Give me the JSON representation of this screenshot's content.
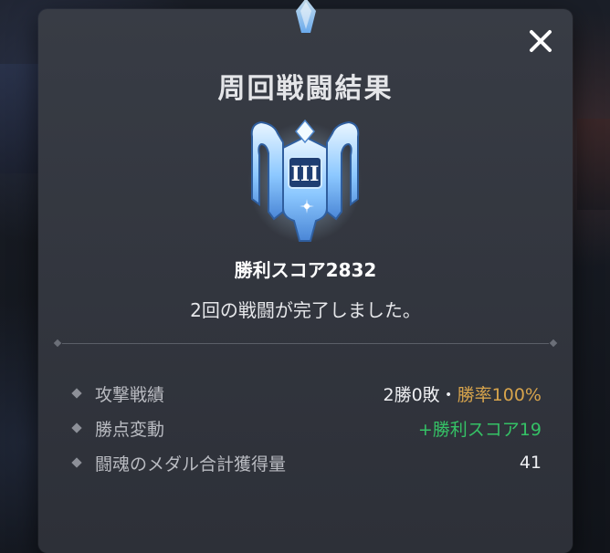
{
  "dialog": {
    "title": "周回戦闘結果",
    "emblem_rank": "III",
    "score_label": "勝利スコア2832",
    "subtitle": "2回の戦闘が完了しました。",
    "close_icon": "close-icon"
  },
  "stats": [
    {
      "label": "攻撃戦績",
      "value_main": "2勝0敗・",
      "value_accent": "勝率100%",
      "accent_color": "#d7a44c"
    },
    {
      "label": "勝点変動",
      "value_main": "",
      "value_accent": "+勝利スコア19",
      "accent_color": "#35c266"
    },
    {
      "label": "闘魂のメダル合計獲得量",
      "value_main": "41",
      "value_accent": ""
    }
  ],
  "colors": {
    "panel": "#383c45",
    "gold": "#d7a44c",
    "green": "#35c266",
    "emblem_blue": "#6fb6ff"
  }
}
